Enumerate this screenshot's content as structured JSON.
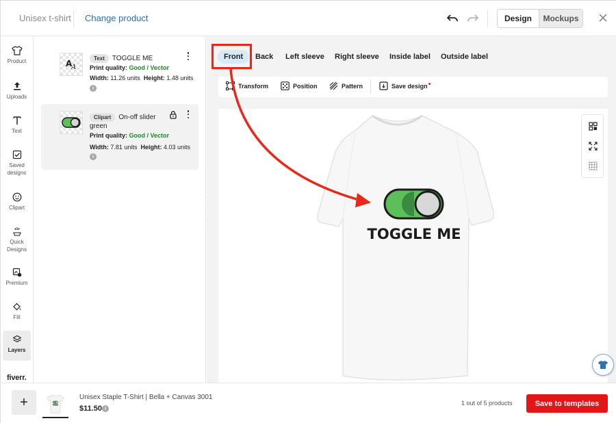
{
  "header": {
    "title": "Unisex t-shirt",
    "change_product": "Change product",
    "view_modes": [
      "Design",
      "Mockups"
    ],
    "active_view": "Design"
  },
  "rail": {
    "items": [
      {
        "label": "Product",
        "icon": "tshirt-icon"
      },
      {
        "label": "Uploads",
        "icon": "upload-icon"
      },
      {
        "label": "Text",
        "icon": "text-icon"
      },
      {
        "label": "Saved designs",
        "icon": "saved-designs-icon"
      },
      {
        "label": "Clipart",
        "icon": "smiley-icon"
      },
      {
        "label": "Quick Designs",
        "icon": "sparkle-icon"
      },
      {
        "label": "Premium",
        "icon": "premium-icon"
      },
      {
        "label": "Fill",
        "icon": "paint-bucket-icon"
      },
      {
        "label": "Layers",
        "icon": "layers-icon"
      }
    ],
    "active": "Layers",
    "brand": "fiverr."
  },
  "layers": [
    {
      "type": "Text",
      "name": "TOGGLE ME",
      "quality_label": "Print quality:",
      "quality": "Good / Vector",
      "width_label": "Width:",
      "width": "11.26 units",
      "height_label": "Height:",
      "height": "1.48 units"
    },
    {
      "type": "Clipart",
      "name": "On-off slider",
      "name_cont": "green",
      "quality_label": "Print quality:",
      "quality": "Good / Vector",
      "width_label": "Width:",
      "width": "7.81 units",
      "height_label": "Height:",
      "height": "4.03 units"
    }
  ],
  "placements": [
    "Front",
    "Back",
    "Left sleeve",
    "Right sleeve",
    "Inside label",
    "Outside label"
  ],
  "active_placement": "Front",
  "toolbar": {
    "transform": "Transform",
    "position": "Position",
    "pattern": "Pattern",
    "save_design": "Save design"
  },
  "design": {
    "text": "TOGGLE ME",
    "toggle_color": "#5cbf5a"
  },
  "footer": {
    "product_name": "Unisex Staple T-Shirt | Bella + Canvas 3001",
    "price": "$11.50",
    "count": "1 out of 5 products",
    "save": "Save to templates"
  },
  "colors": {
    "accent": "#e21616",
    "link": "#2a6fb0",
    "active_tab_bg": "#d6ebf6",
    "good": "#1a8a2a",
    "annotation": "#e8281b"
  }
}
